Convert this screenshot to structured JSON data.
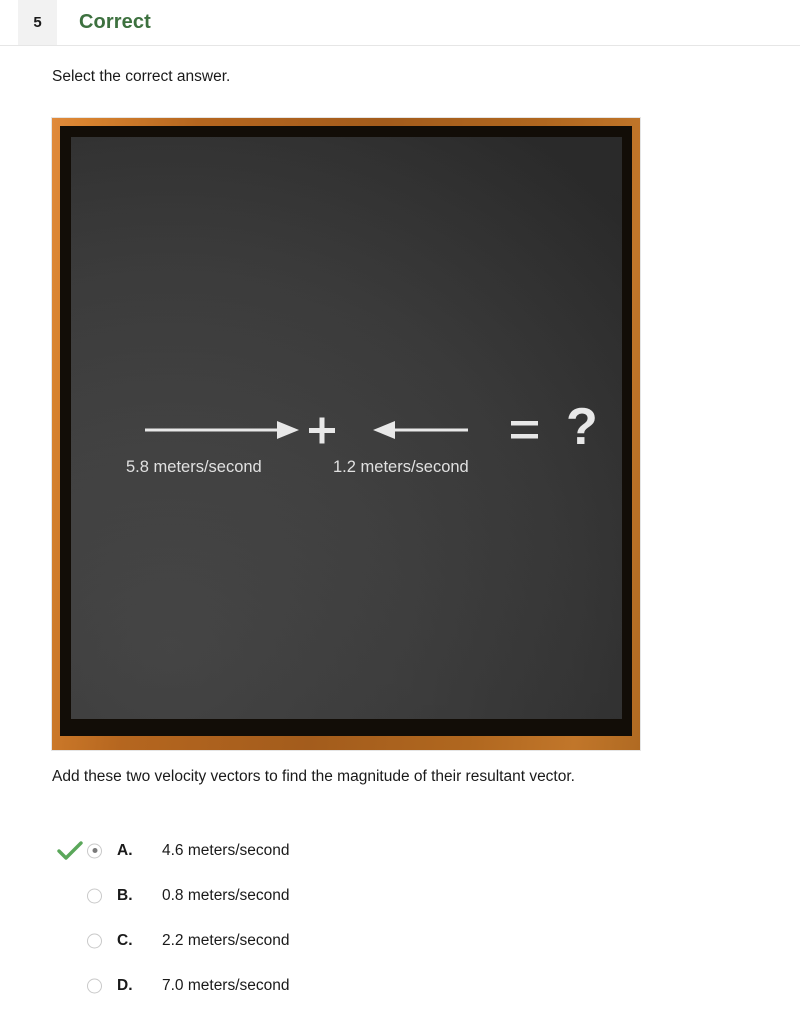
{
  "header": {
    "question_number": "5",
    "status_label": "Correct",
    "status_color": "#3d713f"
  },
  "instruction": "Select the correct answer.",
  "blackboard": {
    "frame_color": "#b5661f",
    "surface_color": "#3d3d3d",
    "chalk_color": "#f4f4f4",
    "vector_left": {
      "label": "5.8 meters/second",
      "direction": "right",
      "magnitude": 5.8
    },
    "operator_plus": "+",
    "vector_right": {
      "label": "1.2 meters/second",
      "direction": "left",
      "magnitude": 1.2
    },
    "operator_equals": "=",
    "result_placeholder": "?"
  },
  "prompt": "Add these two velocity vectors to find the magnitude of their resultant vector.",
  "options": [
    {
      "letter": "A.",
      "text": "4.6 meters/second",
      "selected": true,
      "correct": true
    },
    {
      "letter": "B.",
      "text": "0.8 meters/second",
      "selected": false,
      "correct": false
    },
    {
      "letter": "C.",
      "text": "2.2 meters/second",
      "selected": false,
      "correct": false
    },
    {
      "letter": "D.",
      "text": "7.0 meters/second",
      "selected": false,
      "correct": false
    }
  ],
  "icons": {
    "correct_check": "check-icon",
    "check_color": "#5aa75a"
  }
}
